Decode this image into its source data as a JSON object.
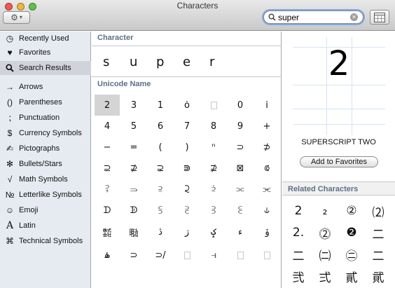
{
  "window": {
    "title": "Characters"
  },
  "toolbar": {
    "search_value": "super",
    "gear_icon": "gear-icon",
    "grid_icon": "character-palette-icon"
  },
  "sidebar": {
    "items": [
      {
        "label": "Recently Used",
        "icon": "clock-icon",
        "glyph": "◷"
      },
      {
        "label": "Favorites",
        "icon": "heart-icon",
        "glyph": "♥"
      },
      {
        "label": "Search Results",
        "icon": "magnifier-icon",
        "glyph": ""
      },
      {
        "label": "Arrows",
        "icon": "arrow-icon",
        "glyph": "→"
      },
      {
        "label": "Parentheses",
        "icon": "parentheses-icon",
        "glyph": "()"
      },
      {
        "label": "Punctuation",
        "icon": "punctuation-icon",
        "glyph": "⁏"
      },
      {
        "label": "Currency Symbols",
        "icon": "dollar-icon",
        "glyph": "$"
      },
      {
        "label": "Pictographs",
        "icon": "pencil-icon",
        "glyph": "✍"
      },
      {
        "label": "Bullets/Stars",
        "icon": "star-bullet-icon",
        "glyph": "✻"
      },
      {
        "label": "Math Symbols",
        "icon": "sqrt-icon",
        "glyph": "√"
      },
      {
        "label": "Letterlike Symbols",
        "icon": "numero-icon",
        "glyph": "№"
      },
      {
        "label": "Emoji",
        "icon": "smiley-icon",
        "glyph": "☺"
      },
      {
        "label": "Latin",
        "icon": "latin-a-icon",
        "glyph": "A"
      },
      {
        "label": "Technical Symbols",
        "icon": "command-icon",
        "glyph": "⌘"
      }
    ]
  },
  "character_section": {
    "heading": "Character",
    "typed": [
      "s",
      "u",
      "p",
      "e",
      "r"
    ]
  },
  "unicode_section": {
    "heading": "Unicode Name"
  },
  "results": [
    [
      "2",
      "3",
      "1",
      "ȯ",
      "□",
      "0",
      "i"
    ],
    [
      "4",
      "5",
      "6",
      "7",
      "8",
      "9",
      "+"
    ],
    [
      "−",
      "=",
      "(",
      ")",
      "ⁿ",
      "⊃",
      "⊅"
    ],
    [
      "⊇",
      "⊉",
      "⊋",
      "⋑",
      "⊉",
      "⊠",
      "⟃"
    ],
    [
      "⫀",
      "⥰",
      "⫆",
      "⫈",
      "⫄",
      "⫗",
      "⫘"
    ],
    [
      "ᗪ",
      "ᗫ",
      "⫓",
      "⫔",
      "⫖",
      "⫕",
      "⫝"
    ],
    [
      "㍿",
      "㍾",
      "ڎ",
      "ڗ",
      "ݤ",
      "ء",
      "ݸ"
    ],
    [
      "ۿ",
      "⊃",
      "⊃/",
      "□",
      "⥽",
      "□",
      "□"
    ]
  ],
  "selected_character": {
    "glyph": "2",
    "name": "SUPERSCRIPT TWO",
    "favorites_button": "Add to Favorites"
  },
  "related": {
    "heading": "Related Characters",
    "chars": [
      [
        "2",
        "₂",
        "②",
        "⑵"
      ],
      [
        "2.",
        "⓶",
        "❷",
        "二"
      ],
      [
        "二",
        "㈡",
        "㊁",
        "二"
      ],
      [
        "弐",
        "弍",
        "貳",
        "貮"
      ]
    ]
  }
}
